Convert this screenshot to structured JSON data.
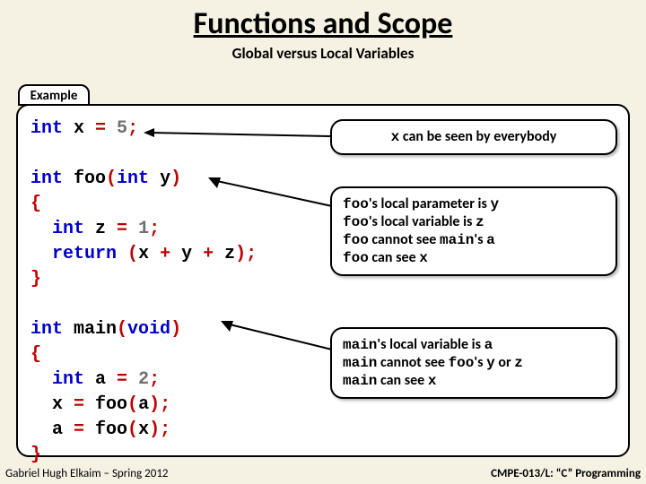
{
  "title": "Functions and Scope",
  "subtitle": "Global versus Local Variables",
  "example_label": "Example",
  "code": {
    "l1a": "int",
    "l1b": " x ",
    "l1c": "=",
    "l1d": " 5",
    "l1e": ";",
    "l2a": "int",
    "l2b": " foo",
    "l2c": "(",
    "l2d": "int",
    "l2e": " y",
    "l2f": ")",
    "l3a": "{",
    "l4a": "  ",
    "l4b": "int",
    "l4c": " z ",
    "l4d": "=",
    "l4e": " 1",
    "l4f": ";",
    "l5a": "  ",
    "l5b": "return",
    "l5c": " ",
    "l5d": "(",
    "l5e": "x ",
    "l5f": "+",
    "l5g": " y ",
    "l5h": "+",
    "l5i": " z",
    "l5j": ");",
    "l6a": "}",
    "l7a": "int",
    "l7b": " main",
    "l7c": "(",
    "l7d": "void",
    "l7e": ")",
    "l8a": "{",
    "l9a": "  ",
    "l9b": "int",
    "l9c": " a ",
    "l9d": "=",
    "l9e": " 2",
    "l9f": ";",
    "l10a": "  x ",
    "l10b": "=",
    "l10c": " foo",
    "l10d": "(",
    "l10e": "a",
    "l10f": ");",
    "l11a": "  a ",
    "l11b": "=",
    "l11c": " foo",
    "l11d": "(",
    "l11e": "x",
    "l11f": ");",
    "l12a": "}"
  },
  "callouts": {
    "c1_pre": "x",
    "c1_post": " can be seen by everybody",
    "c2_l1a": "foo",
    "c2_l1b": "'s local parameter is ",
    "c2_l1c": "y",
    "c2_l2a": "foo",
    "c2_l2b": "'s local variable is ",
    "c2_l2c": "z",
    "c2_l3a": "foo",
    "c2_l3b": " cannot see ",
    "c2_l3c": "main",
    "c2_l3d": "'s ",
    "c2_l3e": "a",
    "c2_l4a": "foo",
    "c2_l4b": " can see ",
    "c2_l4c": "x",
    "c3_l1a": "main",
    "c3_l1b": "'s local variable is ",
    "c3_l1c": "a",
    "c3_l2a": "main",
    "c3_l2b": " cannot see ",
    "c3_l2c": "foo",
    "c3_l2d": "'s ",
    "c3_l2e": "y",
    "c3_l2f": " or ",
    "c3_l2g": "z",
    "c3_l3a": "main",
    "c3_l3b": " can see ",
    "c3_l3c": "x"
  },
  "footer_left": "Gabriel Hugh Elkaim – Spring 2012",
  "footer_right": "CMPE-013/L: “C” Programming"
}
